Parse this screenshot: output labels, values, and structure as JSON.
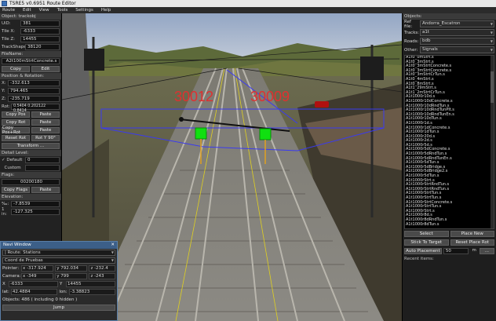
{
  "window": {
    "title": "TSRE5 v0.6951 Route Editor"
  },
  "menu": [
    "Route",
    "Edit",
    "View",
    "Tools",
    "Settings",
    "Help"
  ],
  "left": {
    "object_header": "Object: trackobj",
    "uid_label": "UiD:",
    "uid": "381",
    "tilex_label": "Tile X:",
    "tilex": "-6333",
    "tilez_label": "Tile Z:",
    "tilez": "14455",
    "trackshape_label": "TrackShape:",
    "trackshape": "38120",
    "filename_header": "FileName:",
    "filename": "A2t100mStrtConcrete.s",
    "copy_label": "Copy",
    "edit_label": "Edit",
    "posrot_header": "Position & Rotation:",
    "x_label": "X:",
    "x": "-332.613",
    "y_label": "Y:",
    "y": "794.465",
    "z_label": "Z:",
    "z": "-235.719",
    "rot_label": "Rot:",
    "rot": "0.5404 0.202122 0.8414",
    "copy_pos": "Copy Pos",
    "paste1": "Paste",
    "copy_rot": "Copy Rot",
    "paste2": "Paste",
    "copy_posrot": "Copy Pos+Rot",
    "paste3": "Paste",
    "reset_rot": "Reset Rot",
    "rot_y90": "Rot Y 90°",
    "transform": "Transform ...",
    "detail_header": "Detail Level:",
    "default_label": "Default",
    "default_val": "0",
    "custom_label": "Custom",
    "flags_header": "Flags:",
    "flags": "00200180",
    "copy_flags": "Copy Flags",
    "paste4": "Paste",
    "elevation_header": "Elevation:",
    "elev_pct_label": "‰:",
    "elev_pct": "-7.8539",
    "elev_2_label": "1 in:",
    "elev_2": "-127.325"
  },
  "viewport": {
    "sign_left": "30012",
    "sign_right": "30009"
  },
  "right": {
    "objects_header": "Objects:",
    "reffile_label": "Ref file:",
    "reffile": "Andorra_Escatron",
    "tracks_label": "Tracks:",
    "tracks": "a1t",
    "roads_label": "Roads:",
    "roads": "bdb",
    "other_label": "Other:",
    "other": "Signals",
    "items": [
      "A1t0_0mStrt.s",
      "A1t0_3mStrt.s",
      "A1t0_3mStrtConcrete.s",
      "A1t0_3mStrtConcrete.s",
      "A1t0_3mStrtCrTun.s",
      "A1t0_4mStrt.s",
      "A1t0_8mStrt.s",
      "A1t1_29mStrt.s",
      "A1t1_2mStrtCrTun.s",
      "A1t1000r10d.s",
      "A1t1000r10dConcrete.s",
      "A1t1000r10dRndTun.s",
      "A1t1000r10dRndTunPlt.s",
      "A1t1000r10dRndTunEn.s",
      "A1t1000r10dTun.s",
      "A1t1000r1d.s",
      "A1t1000r1dConcrete.s",
      "A1t1000r1dTun.s",
      "A1t1000r20d.s",
      "A1t1000r2d.s",
      "A1t1000r5d.s",
      "A1t1000r5dConcrete.s",
      "A1t1000r5dRndTun.s",
      "A1t1000r5dRndTunEn.s",
      "A1t1000r5dTun.s",
      "A1t1000r5dBridge.s",
      "A1t1000r5dBridge2.s",
      "A1t1000r5dTun.s",
      "A1t1000rStrt.s",
      "A1t1000rStrtRndTun.s",
      "A1t1000rStrtRndTun.s",
      "A1t1000rStrtTun.s",
      "A1t1000rStrtTun.s",
      "A1t1000rStrtConcrete.s",
      "A1t1000rStrtTun.s",
      "A1t1000rStrt.s",
      "A1t1000r8d.s",
      "A1t1000r8dRndTun.s",
      "A1t1000r8dTun.s"
    ],
    "select": "Select",
    "place_new": "Place New",
    "stick_target": "Stick To Target",
    "reset_place_rot": "Reset Place Rot",
    "auto_placement": "Auto Placement",
    "auto_val": "50",
    "m_label": "m",
    "recent_header": "Recent items:"
  },
  "nav": {
    "title": "Navi Window",
    "route": "| Route: Stations",
    "coord": "Coord de Pruebas",
    "pointer_label": "Pointer:",
    "px": "x -317.924",
    "py": "y 792.034",
    "pz": "z -232.4",
    "camera_label": "Camera:",
    "cx": "x -349",
    "cy": "y 799",
    "cz": "z -243",
    "tile_x_label": "X",
    "tile_x": "-6333",
    "tile_y_label": "Y",
    "tile_y": "14455",
    "lat_label": "lat:",
    "lat": "42.4884",
    "lon_label": "lon:",
    "lon": "-3.38823",
    "objects_count": "Objects: 486 ( including 0 hidden )",
    "jump": "Jump"
  },
  "colors": {
    "nav_title": "#3c5f88",
    "sign": "#e03030",
    "marker": "#10e010",
    "select_line": "#3a3af0"
  }
}
